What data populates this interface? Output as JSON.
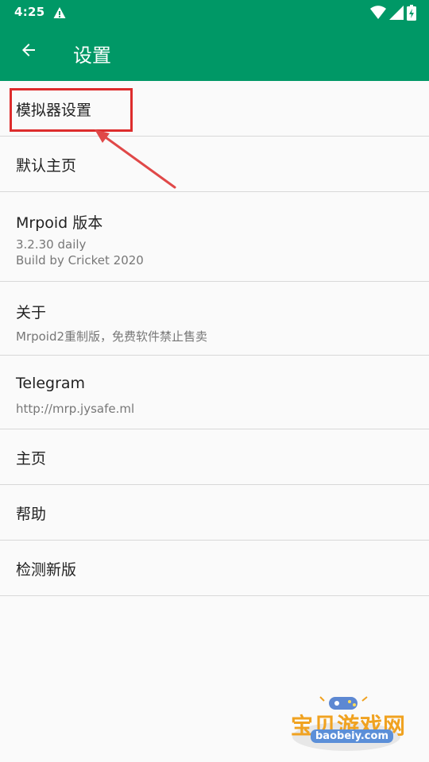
{
  "status_bar": {
    "time": "4:25"
  },
  "app_bar": {
    "title": "设置"
  },
  "settings": [
    {
      "title": "模拟器设置"
    },
    {
      "title": "默认主页"
    },
    {
      "title": "Mrpoid 版本",
      "summary": [
        "3.2.30 daily",
        "Build by Cricket 2020"
      ]
    },
    {
      "title": "关于",
      "summary": [
        "Mrpoid2重制版，免费软件禁止售卖"
      ]
    },
    {
      "title": "Telegram",
      "summary": [
        "http://mrp.jysafe.ml"
      ]
    },
    {
      "title": "主页"
    },
    {
      "title": "帮助"
    },
    {
      "title": "检测新版"
    }
  ],
  "watermark": {
    "name": "宝贝游戏网",
    "url": "baobeiy.com"
  },
  "icons": {
    "back": "arrow-left-icon",
    "warning": "warning-icon",
    "wifi": "wifi-icon",
    "signal": "signal-icon",
    "battery": "battery-charging-icon"
  },
  "colors": {
    "app_bar": "#009866",
    "highlight": "#dd2c2c",
    "background": "#fafafa"
  }
}
